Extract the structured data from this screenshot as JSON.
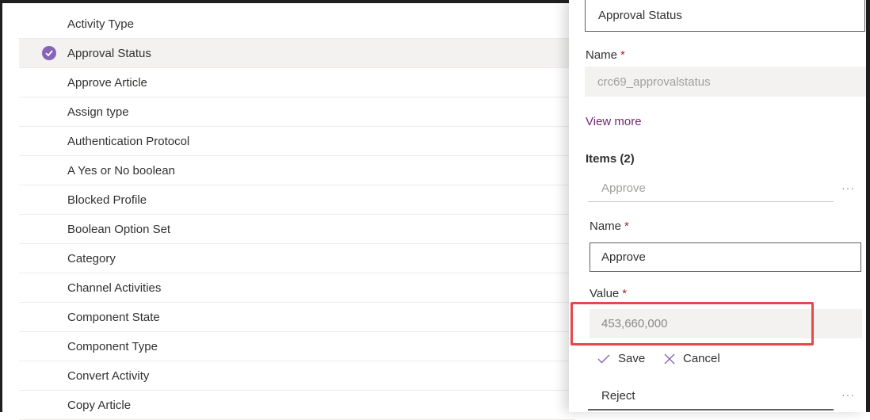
{
  "option_sets": [
    {
      "label": "Activity Type",
      "selected": false
    },
    {
      "label": "Approval Status",
      "selected": true
    },
    {
      "label": "Approve Article",
      "selected": false
    },
    {
      "label": "Assign type",
      "selected": false
    },
    {
      "label": "Authentication Protocol",
      "selected": false
    },
    {
      "label": "A Yes or No boolean",
      "selected": false
    },
    {
      "label": "Blocked Profile",
      "selected": false
    },
    {
      "label": "Boolean Option Set",
      "selected": false
    },
    {
      "label": "Category",
      "selected": false
    },
    {
      "label": "Channel Activities",
      "selected": false
    },
    {
      "label": "Component State",
      "selected": false
    },
    {
      "label": "Component Type",
      "selected": false
    },
    {
      "label": "Convert Activity",
      "selected": false
    },
    {
      "label": "Copy Article",
      "selected": false
    }
  ],
  "panel": {
    "display_name_value": "Approval Status",
    "name_label": "Name",
    "required_marker": "*",
    "name_value": "crc69_approvalstatus",
    "view_more": "View more",
    "items_header": "Items (2)",
    "items": [
      {
        "label": "Approve"
      },
      {
        "label": "Reject"
      }
    ],
    "more_glyph": "···",
    "edit": {
      "name_label": "Name",
      "name_value": "Approve",
      "value_label": "Value",
      "value_value": "453,660,000",
      "save_label": "Save",
      "cancel_label": "Cancel"
    }
  },
  "colors": {
    "accent": "#742774",
    "check": "#8764b8",
    "required": "#a4262c",
    "highlight": "#e8474b"
  },
  "icons": {
    "selected": "check-circle-icon",
    "save": "checkmark-icon",
    "cancel": "close-icon",
    "more": "more-icon"
  }
}
